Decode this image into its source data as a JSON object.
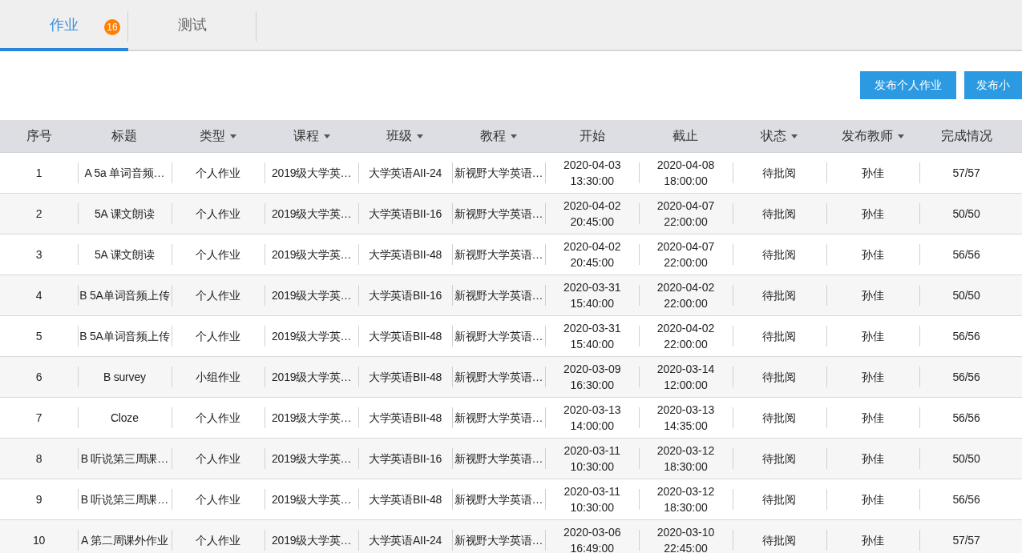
{
  "tabs": [
    {
      "label": "作业",
      "selected": true,
      "badge": "16"
    },
    {
      "label": "测试",
      "selected": false
    }
  ],
  "buttons": [
    "发布个人作业",
    "发布小"
  ],
  "table": {
    "columns": [
      {
        "label": "序号",
        "filter": false
      },
      {
        "label": "标题",
        "filter": false
      },
      {
        "label": "类型",
        "filter": true
      },
      {
        "label": "课程",
        "filter": true
      },
      {
        "label": "班级",
        "filter": true
      },
      {
        "label": "教程",
        "filter": true
      },
      {
        "label": "开始",
        "filter": false
      },
      {
        "label": "截止",
        "filter": false
      },
      {
        "label": "状态",
        "filter": true
      },
      {
        "label": "发布教师",
        "filter": true
      },
      {
        "label": "完成情况",
        "filter": false
      }
    ],
    "rows": [
      [
        "1",
        "A 5a 单词音频…",
        "个人作业",
        "2019级大学英…",
        "大学英语AII-24",
        "新视野大学英语…",
        "2020-04-03 13:30:00",
        "2020-04-08 18:00:00",
        "待批阅",
        "孙佳",
        "57/57"
      ],
      [
        "2",
        "5A 课文朗读",
        "个人作业",
        "2019级大学英…",
        "大学英语BII-16",
        "新视野大学英语…",
        "2020-04-02 20:45:00",
        "2020-04-07 22:00:00",
        "待批阅",
        "孙佳",
        "50/50"
      ],
      [
        "3",
        "5A 课文朗读",
        "个人作业",
        "2019级大学英…",
        "大学英语BII-48",
        "新视野大学英语…",
        "2020-04-02 20:45:00",
        "2020-04-07 22:00:00",
        "待批阅",
        "孙佳",
        "56/56"
      ],
      [
        "4",
        "B 5A单词音频上传",
        "个人作业",
        "2019级大学英…",
        "大学英语BII-16",
        "新视野大学英语…",
        "2020-03-31 15:40:00",
        "2020-04-02 22:00:00",
        "待批阅",
        "孙佳",
        "50/50"
      ],
      [
        "5",
        "B 5A单词音频上传",
        "个人作业",
        "2019级大学英…",
        "大学英语BII-48",
        "新视野大学英语…",
        "2020-03-31 15:40:00",
        "2020-04-02 22:00:00",
        "待批阅",
        "孙佳",
        "56/56"
      ],
      [
        "6",
        "B survey",
        "小组作业",
        "2019级大学英…",
        "大学英语BII-48",
        "新视野大学英语…",
        "2020-03-09 16:30:00",
        "2020-03-14 12:00:00",
        "待批阅",
        "孙佳",
        "56/56"
      ],
      [
        "7",
        "Cloze",
        "个人作业",
        "2019级大学英…",
        "大学英语BII-48",
        "新视野大学英语…",
        "2020-03-13 14:00:00",
        "2020-03-13 14:35:00",
        "待批阅",
        "孙佳",
        "56/56"
      ],
      [
        "8",
        "B 听说第三周课…",
        "个人作业",
        "2019级大学英…",
        "大学英语BII-16",
        "新视野大学英语…",
        "2020-03-11 10:30:00",
        "2020-03-12 18:30:00",
        "待批阅",
        "孙佳",
        "50/50"
      ],
      [
        "9",
        "B 听说第三周课…",
        "个人作业",
        "2019级大学英…",
        "大学英语BII-48",
        "新视野大学英语…",
        "2020-03-11 10:30:00",
        "2020-03-12 18:30:00",
        "待批阅",
        "孙佳",
        "56/56"
      ],
      [
        "10",
        "A 第二周课外作业",
        "个人作业",
        "2019级大学英…",
        "大学英语AII-24",
        "新视野大学英语…",
        "2020-03-06 16:49:00",
        "2020-03-10 22:45:00",
        "待批阅",
        "孙佳",
        "57/57"
      ]
    ]
  }
}
